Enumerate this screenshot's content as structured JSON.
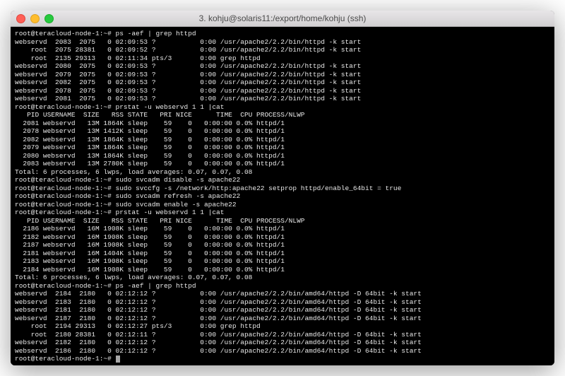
{
  "window": {
    "title": "3. kohju@solaris11:/export/home/kohju (ssh)"
  },
  "prompts": {
    "p1": "root@teracloud-node-1:~# ",
    "cmd1": "ps -aef | grep httpd",
    "cmd2": "prstat -u webservd 1 1 |cat",
    "cmd3": "sudo svcadm disable -s apache22",
    "cmd4": "sudo svccfg -s /network/http:apache22 setprop httpd/enable_64bit = true",
    "cmd5": "sudo svcadm refresh -s apache22",
    "cmd6": "sudo svcadm enable -s apache22",
    "cmd7": "prstat -u webservd 1 1 |cat",
    "cmd8": "ps -aef | grep httpd"
  },
  "ps1": [
    "webservd  2083  2075   0 02:09:53 ?           0:00 /usr/apache2/2.2/bin/httpd -k start",
    "    root  2075 28381   0 02:09:52 ?           0:00 /usr/apache2/2.2/bin/httpd -k start",
    "    root  2135 29313   0 02:11:34 pts/3       0:00 grep httpd",
    "webservd  2080  2075   0 02:09:53 ?           0:00 /usr/apache2/2.2/bin/httpd -k start",
    "webservd  2079  2075   0 02:09:53 ?           0:00 /usr/apache2/2.2/bin/httpd -k start",
    "webservd  2082  2075   0 02:09:53 ?           0:00 /usr/apache2/2.2/bin/httpd -k start",
    "webservd  2078  2075   0 02:09:53 ?           0:00 /usr/apache2/2.2/bin/httpd -k start",
    "webservd  2081  2075   0 02:09:53 ?           0:00 /usr/apache2/2.2/bin/httpd -k start"
  ],
  "prstat1": {
    "header": "   PID USERNAME  SIZE   RSS STATE   PRI NICE      TIME  CPU PROCESS/NLWP",
    "rows": [
      "  2081 webservd   13M 1864K sleep    59    0   0:00:00 0.0% httpd/1",
      "  2078 webservd   13M 1412K sleep    59    0   0:00:00 0.0% httpd/1",
      "  2082 webservd   13M 1864K sleep    59    0   0:00:00 0.0% httpd/1",
      "  2079 webservd   13M 1864K sleep    59    0   0:00:00 0.0% httpd/1",
      "  2080 webservd   13M 1864K sleep    59    0   0:00:00 0.0% httpd/1",
      "  2083 webservd   13M 2780K sleep    59    0   0:00:00 0.0% httpd/1"
    ],
    "total": "Total: 6 processes, 6 lwps, load averages: 0.07, 0.07, 0.08"
  },
  "prstat2": {
    "header": "   PID USERNAME  SIZE   RSS STATE   PRI NICE      TIME  CPU PROCESS/NLWP",
    "rows": [
      "  2186 webservd   16M 1908K sleep    59    0   0:00:00 0.0% httpd/1",
      "  2182 webservd   16M 1908K sleep    59    0   0:00:00 0.0% httpd/1",
      "  2187 webservd   16M 1908K sleep    59    0   0:00:00 0.0% httpd/1",
      "  2181 webservd   16M 1404K sleep    59    0   0:00:00 0.0% httpd/1",
      "  2183 webservd   16M 1908K sleep    59    0   0:00:00 0.0% httpd/1",
      "  2184 webservd   16M 1908K sleep    59    0   0:00:00 0.0% httpd/1"
    ],
    "total": "Total: 6 processes, 6 lwps, load averages: 0.07, 0.07, 0.08"
  },
  "ps2": [
    "webservd  2184  2180   0 02:12:12 ?           0:00 /usr/apache2/2.2/bin/amd64/httpd -D 64bit -k start",
    "webservd  2183  2180   0 02:12:12 ?           0:00 /usr/apache2/2.2/bin/amd64/httpd -D 64bit -k start",
    "webservd  2181  2180   0 02:12:12 ?           0:00 /usr/apache2/2.2/bin/amd64/httpd -D 64bit -k start",
    "webservd  2187  2180   0 02:12:12 ?           0:00 /usr/apache2/2.2/bin/amd64/httpd -D 64bit -k start",
    "    root  2194 29313   0 02:12:27 pts/3       0:00 grep httpd",
    "    root  2180 28381   0 02:12:11 ?           0:00 /usr/apache2/2.2/bin/amd64/httpd -D 64bit -k start",
    "webservd  2182  2180   0 02:12:12 ?           0:00 /usr/apache2/2.2/bin/amd64/httpd -D 64bit -k start",
    "webservd  2186  2180   0 02:12:12 ?           0:00 /usr/apache2/2.2/bin/amd64/httpd -D 64bit -k start"
  ]
}
